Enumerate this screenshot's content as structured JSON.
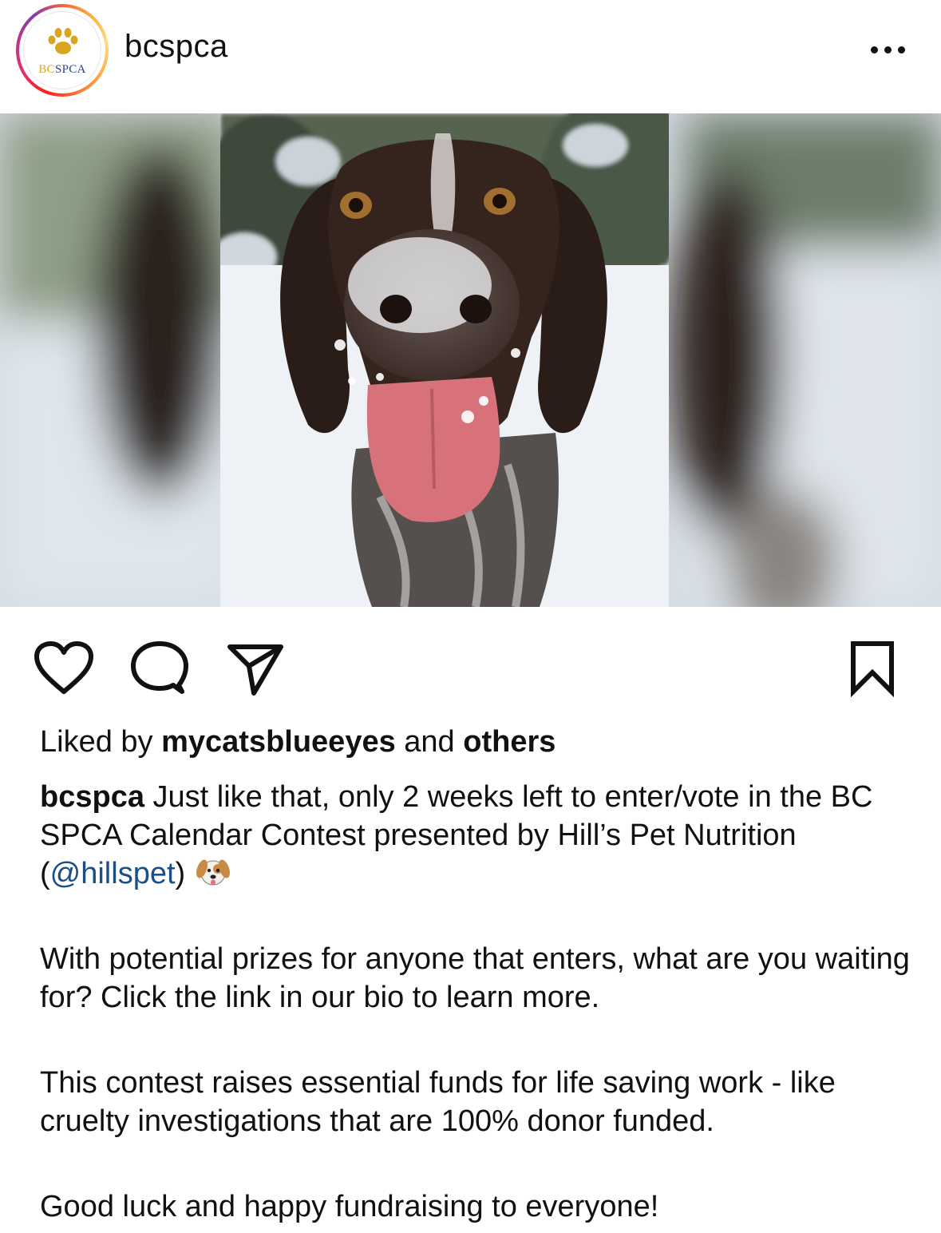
{
  "header": {
    "username": "bcspca",
    "avatar": {
      "logo_text_bc": "BC",
      "logo_text_spca": "SPCA",
      "paw_color": "#d9a520",
      "ring_colors": [
        "#fd1d1d",
        "#c13584",
        "#fcaf45"
      ]
    },
    "more_icon": "ellipsis-icon"
  },
  "media": {
    "subject": "dog-in-snow-photo",
    "tag_icon": "user-tag-icon"
  },
  "actions": {
    "like_icon": "heart-icon",
    "comment_icon": "comment-icon",
    "share_icon": "send-icon",
    "save_icon": "bookmark-icon"
  },
  "likes": {
    "prefix": "Liked by ",
    "user": "mycatsblueeyes",
    "middle": " and ",
    "others": "others"
  },
  "caption": {
    "author": "bcspca",
    "line1_before_mention": " Just like that, only 2 weeks left to enter/vote in the BC SPCA Calendar Contest presented by Hill’s Pet Nutrition (",
    "mention": "@hillspet",
    "line1_after_mention": ") ",
    "emoji": "dog-face-emoji",
    "paragraph2": "With potential prizes for anyone that enters, what are you waiting for? Click the link in our bio to learn more.",
    "paragraph3": "This contest raises essential funds for life saving work - like cruelty investigations that are 100% donor funded.",
    "paragraph4": "Good luck and happy fundraising to everyone!"
  },
  "colors": {
    "mention": "#1c4e86",
    "text": "#111111"
  }
}
